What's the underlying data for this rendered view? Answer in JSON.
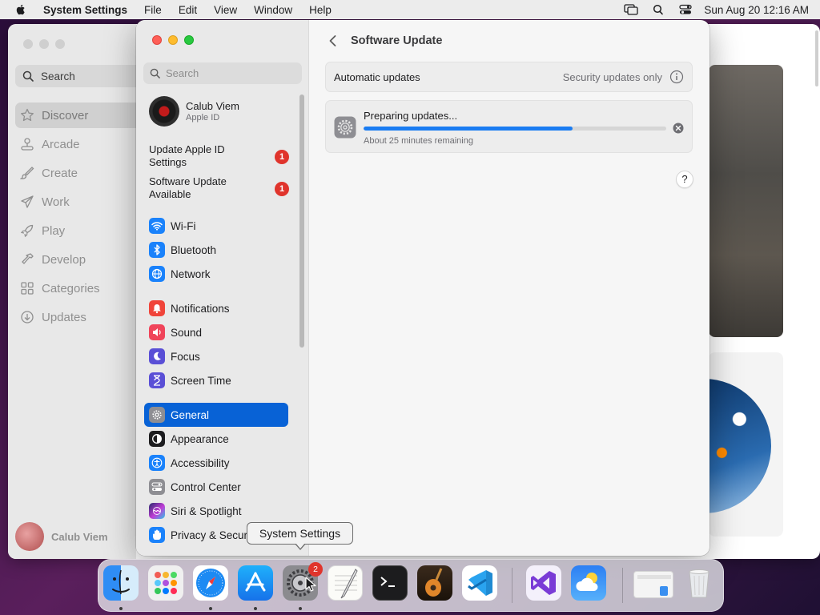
{
  "menubar": {
    "app_name": "System Settings",
    "menus": [
      "File",
      "Edit",
      "View",
      "Window",
      "Help"
    ],
    "clock": "Sun Aug 20  12:16 AM"
  },
  "store": {
    "search_label": "Search",
    "nav": [
      "Discover",
      "Arcade",
      "Create",
      "Work",
      "Play",
      "Develop",
      "Categories",
      "Updates"
    ],
    "active_nav": "Discover",
    "user_name": "Calub Viem"
  },
  "settings": {
    "search_placeholder": "Search",
    "account": {
      "name": "Calub Viem",
      "subtitle": "Apple ID"
    },
    "notices": [
      {
        "label": "Update Apple ID Settings",
        "badge": "1"
      },
      {
        "label": "Software Update Available",
        "badge": "1"
      }
    ],
    "nav_groups": {
      "network": [
        "Wi-Fi",
        "Bluetooth",
        "Network"
      ],
      "attention": [
        "Notifications",
        "Sound",
        "Focus",
        "Screen Time"
      ],
      "system": [
        "General",
        "Appearance",
        "Accessibility",
        "Control Center",
        "Siri & Spotlight",
        "Privacy & Secur"
      ]
    },
    "selected_nav": "General",
    "page_title": "Software Update",
    "automatic_updates": {
      "label": "Automatic updates",
      "value": "Security updates only"
    },
    "progress": {
      "title": "Preparing updates...",
      "subtitle": "About 25 minutes remaining",
      "fraction": 0.69
    },
    "help_label": "?"
  },
  "dock": {
    "tooltip": "System Settings",
    "settings_badge": "2",
    "apps": [
      "Finder",
      "Launchpad",
      "Safari",
      "App Store",
      "System Settings",
      "TextEdit",
      "Terminal",
      "GarageBand",
      "Visual Studio Code",
      "Visual Studio",
      "Weather",
      "Preview",
      "Trash"
    ]
  },
  "colors": {
    "accent": "#0862d6",
    "progress": "#1a7cf2",
    "badge": "#e0342c"
  }
}
